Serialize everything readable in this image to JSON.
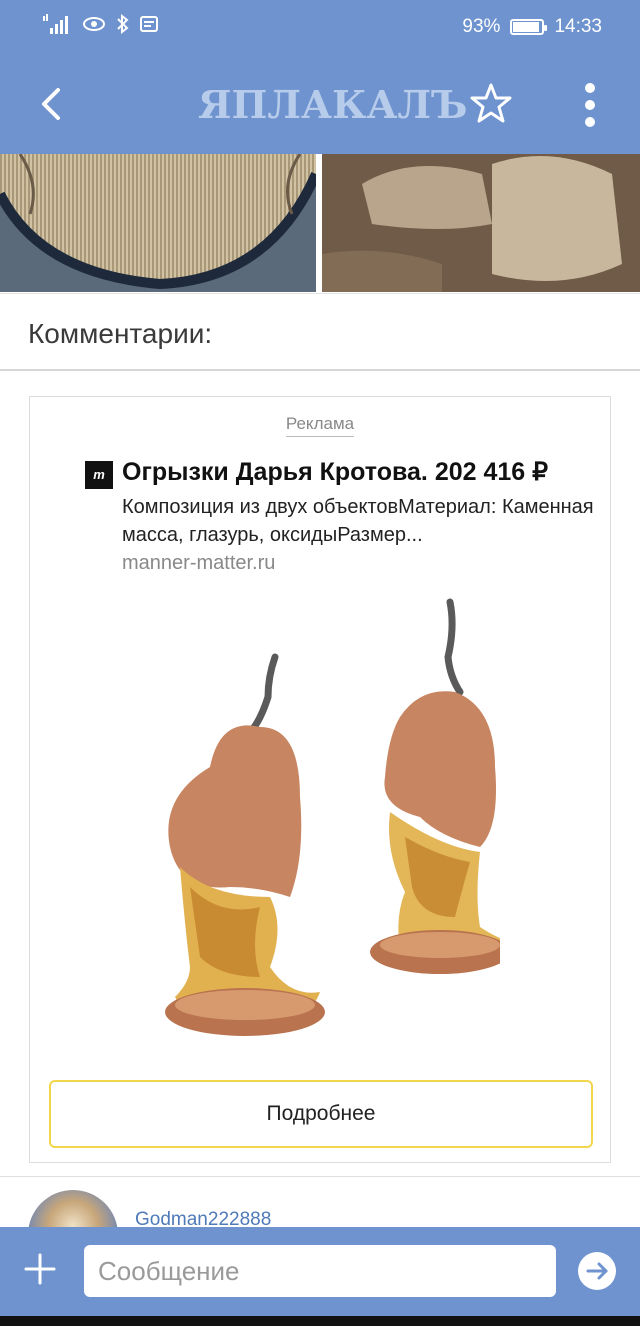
{
  "status_bar": {
    "battery_percent": "93%",
    "battery_level": 0.93,
    "time": "14:33"
  },
  "app_bar": {
    "logo_text": "ЯПЛАКАЛЪ",
    "icons": [
      "back-arrow-icon",
      "star-icon",
      "more-vertical-icon"
    ]
  },
  "comments": {
    "header": "Комментарии:"
  },
  "ad": {
    "label": "Реклама",
    "title": "Огрызки Дарья Кротова. 202 416 ₽",
    "description": "Композиция из двух объектовМатериал: Каменная масса, глазурь, оксидыРазмер...",
    "domain": "manner-matter.ru",
    "button_label": "Подробнее",
    "logo_mark": "m"
  },
  "comment_peek": {
    "username": "Godman222888"
  },
  "message_bar": {
    "placeholder": "Сообщение",
    "icons": [
      "plus-icon",
      "send-arrow-icon"
    ]
  },
  "colors": {
    "primary": "#6e93cf",
    "button_border": "#f2d64b",
    "link": "#4f7ab8"
  }
}
